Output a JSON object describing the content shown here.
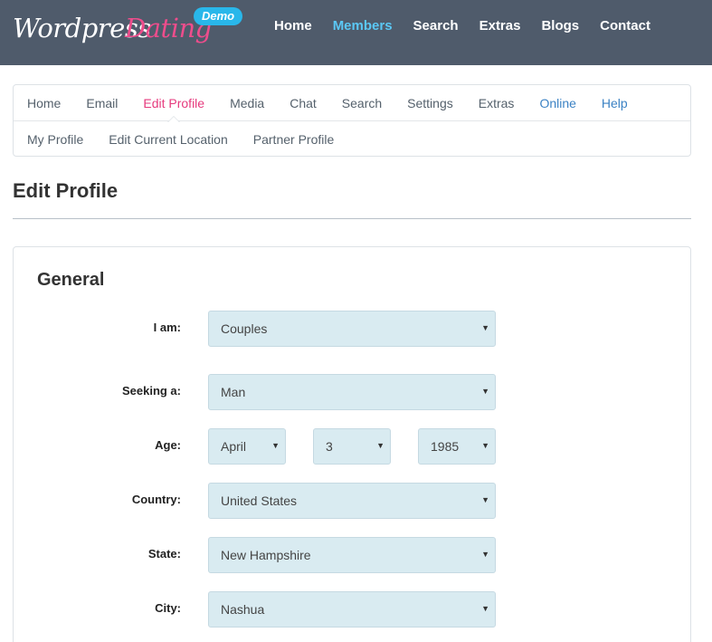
{
  "header": {
    "logo_part1": "Wordpress",
    "logo_part2": "Dating",
    "badge": "Demo",
    "nav": [
      {
        "label": "Home"
      },
      {
        "label": "Members",
        "active": true
      },
      {
        "label": "Search"
      },
      {
        "label": "Extras"
      },
      {
        "label": "Blogs"
      },
      {
        "label": "Contact"
      }
    ]
  },
  "subnav": {
    "row1": [
      "Home",
      "Email",
      "Edit Profile",
      "Media",
      "Chat",
      "Search",
      "Settings",
      "Extras",
      "Online",
      "Help"
    ],
    "row2": [
      "My Profile",
      "Edit Current Location",
      "Partner Profile"
    ]
  },
  "page": {
    "title": "Edit Profile",
    "section": "General"
  },
  "form": {
    "i_am": {
      "label": "I am:",
      "value": "Couples"
    },
    "seeking": {
      "label": "Seeking a:",
      "value": "Man"
    },
    "age": {
      "label": "Age:",
      "month": "April",
      "day": "3",
      "year": "1985"
    },
    "country": {
      "label": "Country:",
      "value": "United States"
    },
    "state": {
      "label": "State:",
      "value": "New Hampshire"
    },
    "city": {
      "label": "City:",
      "value": "Nashua"
    }
  },
  "colors": {
    "header_bg": "#4f5b6b",
    "accent_pink": "#e63a7d",
    "accent_blue": "#5bc8f5",
    "select_bg": "#d9ebf1"
  }
}
